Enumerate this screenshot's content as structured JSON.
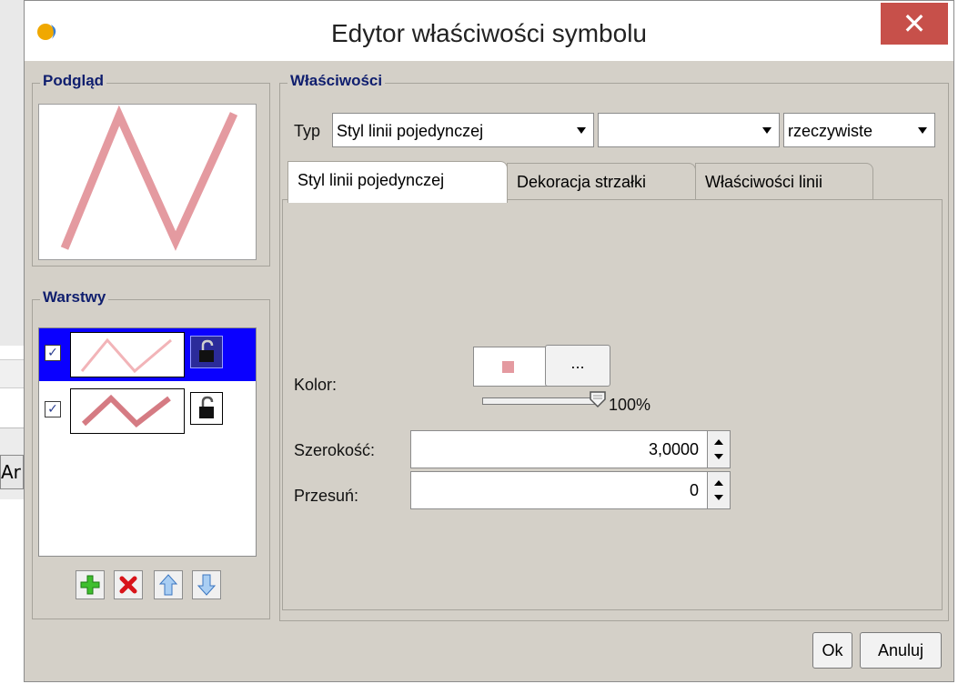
{
  "background_app": {
    "button_text": "Ar"
  },
  "dialog": {
    "title": "Edytor właściwości symbolu",
    "close_glyph": "✕",
    "accent_close": "#c7504a",
    "selection_color": "#0a00ff",
    "line_color": "#e49aa0"
  },
  "preview": {
    "label": "Podgląd"
  },
  "layers": {
    "label": "Warstwy",
    "items": [
      {
        "checked": "✓",
        "selected": true,
        "lock_icon": "lock-open-icon"
      },
      {
        "checked": "✓",
        "selected": false,
        "lock_icon": "lock-open-icon"
      }
    ],
    "toolbar": [
      "add-icon",
      "delete-icon",
      "arrow-up-icon",
      "arrow-down-icon"
    ]
  },
  "properties": {
    "label": "Właściwości",
    "type_label": "Typ",
    "type_value": "Styl linii pojedynczej",
    "second_combo_value": "",
    "unit_value": "rzeczywiste",
    "tabs": [
      {
        "label": "Styl linii pojedynczej",
        "active": true
      },
      {
        "label": "Dekoracja strzałki",
        "active": false
      },
      {
        "label": "Właściwości linii",
        "active": false
      }
    ],
    "color_label": "Kolor:",
    "color_button": "...",
    "opacity_value": "100%",
    "width_label": "Szerokość:",
    "width_value": "3,0000",
    "offset_label": "Przesuń:",
    "offset_value": "0"
  },
  "buttons": {
    "ok": "Ok",
    "cancel": "Anuluj"
  }
}
